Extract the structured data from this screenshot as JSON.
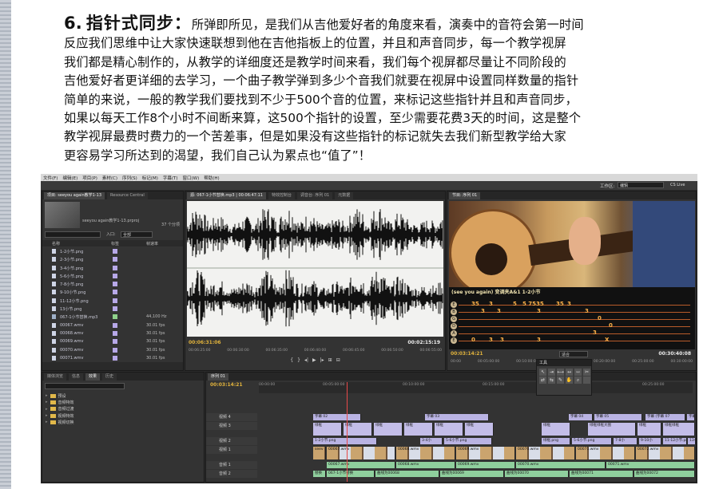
{
  "paragraph": {
    "number": "6.",
    "heading": "指针式同步",
    "colon": "：",
    "lines": [
      "所弹即所见，是我们从吉他爱好者的角度来看，演奏中的音符会第一时间",
      "反应我们思维中让大家快速联想到他在吉他指板上的位置，并且和声音同步，每一个教学视屏",
      "我们都是精心制作的，从教学的详细度还是教学时间来看，我们每个视屏都尽量让不同阶段的",
      "吉他爱好者更详细的去学习，一个曲子教学弹到多少个音我们就要在视屏中设置同样数量的指针",
      "简单的来说，一般的教学我们要找到不少于500个音的位置，来标记这些指针并且和声音同步，",
      "如果以每天工作8个小时不间断来算，这500个指针的设置，至少需要花费3天的时间，这是整个",
      "教学视屏最费时费力的一个苦差事，但是如果没有这些指针的标记就失去我们新型教学给大家",
      "更容易学习所达到的渴望，我们自己认为累点也“值了”！"
    ]
  },
  "app": {
    "menu": [
      "文件(F)",
      "编辑(E)",
      "项目(P)",
      "素材(C)",
      "序列(S)",
      "标记(M)",
      "字幕(T)",
      "窗口(W)",
      "帮助(H)"
    ],
    "workspace_label": "工作区:",
    "workspace_value": "编辑",
    "cs_live": "CS Live",
    "project": {
      "tabs": [
        "项目: seeyou again教学1-13",
        "Resource Central"
      ],
      "project_file": "seeyou again教学1-13.prproj",
      "item_count": "37 个分项",
      "in_label": "入口:",
      "in_value": "全部",
      "columns": [
        "名称",
        "标签",
        "帧速率"
      ],
      "items": [
        {
          "name": "1-2小节.png",
          "rate": "",
          "color": "purple"
        },
        {
          "name": "2-3小节.png",
          "rate": "",
          "color": "purple"
        },
        {
          "name": "3-4小节.png",
          "rate": "",
          "color": "purple"
        },
        {
          "name": "5-6小节.png",
          "rate": "",
          "color": "purple"
        },
        {
          "name": "7-8小节.png",
          "rate": "",
          "color": "purple"
        },
        {
          "name": "9-10小节.png",
          "rate": "",
          "color": "purple"
        },
        {
          "name": "11-12小节.png",
          "rate": "",
          "color": "purple"
        },
        {
          "name": "13小节.png",
          "rate": "",
          "color": "purple"
        },
        {
          "name": "067-1小节替换.mp3",
          "rate": "44,100 Hz",
          "color": "green"
        },
        {
          "name": "00067.wmv",
          "rate": "30.01 fps",
          "color": "purple"
        },
        {
          "name": "00068.wmv",
          "rate": "30.01 fps",
          "color": "purple"
        },
        {
          "name": "00069.wmv",
          "rate": "30.01 fps",
          "color": "purple"
        },
        {
          "name": "00070.wmv",
          "rate": "30.01 fps",
          "color": "purple"
        },
        {
          "name": "00071.wmv",
          "rate": "30.01 fps",
          "color": "purple"
        }
      ]
    },
    "source": {
      "tabs": [
        "源: 067-1小节替换.mp3 | 00:06:47:11",
        "特效控制台",
        "调音台: 序列 01",
        "元数据"
      ],
      "timecode_in": "00:06:31:06",
      "timecode_dur": "00:02:15:19",
      "ruler": [
        "00:06:25:00",
        "00:06:30:00",
        "00:06:35:00",
        "00:06:40:00",
        "00:06:45:00",
        "00:06:50:00",
        "00:06:55:00"
      ]
    },
    "program": {
      "tabs": [
        "节目: 序列 01"
      ],
      "overlay_title": "(see you again) 变调夹A&1 1-2小节",
      "string_letters": [
        "E",
        "B",
        "G",
        "D",
        "A",
        "E"
      ],
      "tab_numbers": [
        "35",
        "3",
        "5",
        "5 7535",
        "35",
        "3",
        "3",
        "3",
        "3",
        "3",
        "0",
        "0",
        "3",
        "X",
        "0",
        "3",
        "3",
        "3"
      ],
      "timecode": "00:03:14:21",
      "fit": "适合",
      "duration": "00:30:40:08",
      "ruler": [
        "00:00",
        "00:05:00:00",
        "00:10:00:00",
        "00:15:00:00",
        "00:20:00:00",
        "00:25:00:00",
        "00:30:00:00"
      ]
    },
    "effects": {
      "tabs": [
        "媒体浏览",
        "信息",
        "效果",
        "历史"
      ],
      "folders": [
        "预设",
        "音频特效",
        "音频过渡",
        "视频特效",
        "视频切换"
      ]
    },
    "sequence": {
      "tab": "序列 01",
      "timecode": "00:03:14:21",
      "ruler": [
        "00:00:00",
        "00:05:00:00",
        "00:10:00:00",
        "00:15:00:00",
        "00:20:00:00",
        "00:25:00:00"
      ],
      "tracks": [
        "视频 4",
        "视频 3",
        "视频 2",
        "视频 1",
        "音频 1",
        "音频 2"
      ],
      "clip_labels": {
        "v4": [
          "字幕 02",
          "字幕 03",
          "字幕 04",
          "字幕 05",
          "字幕 (字幕 07",
          "字幕"
        ],
        "v3": [
          "绿框",
          "绿框",
          "绿框",
          "绿框",
          "绿框",
          "绿框",
          "绿框",
          "绿框绿框大图",
          "绿框",
          "绿框绿框"
        ],
        "v2": [
          "1-2小节.png",
          "3-4小",
          "5-6小节.png",
          "绿框.png",
          "5-6小节.png",
          "7-8小",
          "9-10小",
          "11-12小节.pn",
          "13小"
        ],
        "v1": [
          "seev",
          "00067.wmv",
          "00068.wmv",
          "00069.wmv",
          "00070.wmv",
          "00071.wmv",
          "00072.wmv"
        ],
        "a1": [
          "00067.wmv",
          "00068.wmv",
          "00069.wmv",
          "00070.wmv",
          "00071.wmv"
        ],
        "a2": [
          "替换",
          "067-1小节替换",
          "曲线为00068",
          "曲线为00069",
          "曲线为00070",
          "曲线为00071",
          "曲线为00072"
        ]
      },
      "tools_title": "工具"
    }
  }
}
